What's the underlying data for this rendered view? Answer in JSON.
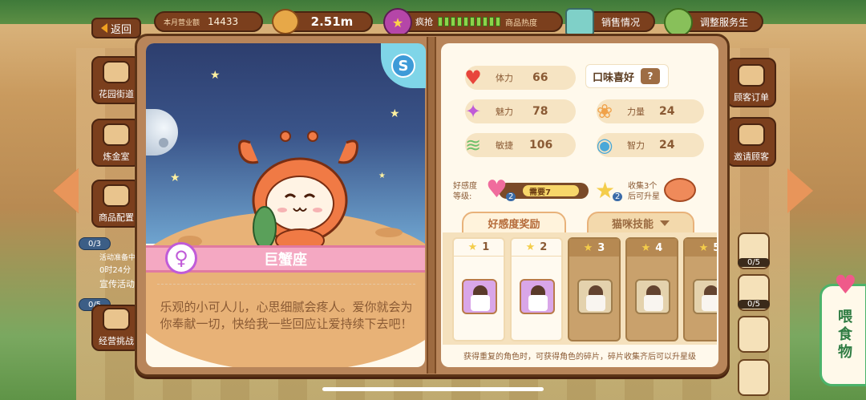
{
  "topbar": {
    "back_label": "返回",
    "revenue_label": "本月营业额",
    "revenue_value": "14433",
    "money_value": "2.51m",
    "heat_state": "疯抢",
    "heat_label": "商品热度",
    "heat_level_segments": 10,
    "sales_label": "销售情况",
    "service_label": "调整服务生"
  },
  "left_menu": {
    "items": [
      {
        "label": "花园街道"
      },
      {
        "label": "炼金室"
      },
      {
        "label": "商品配置"
      },
      {
        "label": "宣传活动"
      },
      {
        "label": "经营挑战"
      }
    ],
    "promo_count": "0/3",
    "promo_status": "活动准备中",
    "promo_timer": "0时24分",
    "challenge_count": "0/5"
  },
  "right_menu": {
    "items": [
      {
        "label": "顾客订单"
      },
      {
        "label": "邀请顾客"
      }
    ],
    "tool_counts": [
      "0/5",
      "0/5"
    ]
  },
  "character": {
    "rank": "S",
    "name": "巨蟹座",
    "gender_symbol": "♀",
    "description": "乐观的小可人儿，心思细腻会疼人。爱你就会为你奉献一切，快给我一些回应让爱持续下去吧！"
  },
  "stats": {
    "stamina_label": "体力",
    "stamina_value": "66",
    "charm_label": "魅力",
    "charm_value": "78",
    "strength_label": "力量",
    "strength_value": "24",
    "agility_label": "敏捷",
    "agility_value": "106",
    "intelligence_label": "智力",
    "intelligence_value": "24",
    "taste_label": "口味喜好",
    "taste_value": "?"
  },
  "affinity": {
    "label": "好感度等级:",
    "level": "2",
    "need_text": "需要7",
    "collect_count": "2",
    "collect_text": "收集3个后可升星"
  },
  "tabs": {
    "reward": "好感度奖励",
    "skill": "猫咪技能"
  },
  "cards": [
    {
      "level": "1",
      "unlocked": true
    },
    {
      "level": "2",
      "unlocked": true
    },
    {
      "level": "3",
      "unlocked": false
    },
    {
      "level": "4",
      "unlocked": false
    },
    {
      "level": "5",
      "unlocked": false
    }
  ],
  "hint": "获得重复的角色时，可获得角色的碎片，碎片收集齐后可以升星级",
  "feed_button": "喂食物",
  "colors": {
    "panel": "#b8855a",
    "page": "#fff9ec",
    "ribbon": "#f4a8c2",
    "feed": "#4cb36a",
    "heart": "#ef5a8a"
  }
}
